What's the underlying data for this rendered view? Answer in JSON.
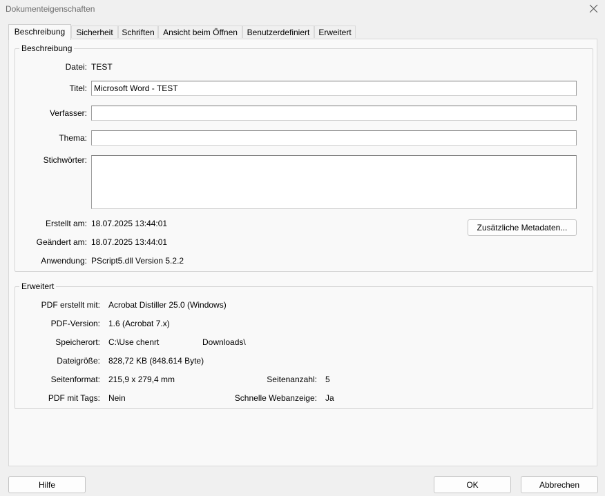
{
  "window": {
    "title": "Dokumenteigenschaften"
  },
  "tabs": [
    {
      "label": "Beschreibung",
      "active": true
    },
    {
      "label": "Sicherheit"
    },
    {
      "label": "Schriften"
    },
    {
      "label": "Ansicht beim Öffnen"
    },
    {
      "label": "Benutzerdefiniert"
    },
    {
      "label": "Erweitert"
    }
  ],
  "description": {
    "group_label": "Beschreibung",
    "file_label": "Datei:",
    "file_value": "TEST",
    "title_label": "Titel:",
    "title_value": "Microsoft Word - TEST",
    "author_label": "Verfasser:",
    "author_value": "",
    "subject_label": "Thema:",
    "subject_value": "",
    "keywords_label": "Stichwörter:",
    "keywords_value": "",
    "created_label": "Erstellt am:",
    "created_value": "18.07.2025 13:44:01",
    "modified_label": "Geändert am:",
    "modified_value": "18.07.2025 13:44:01",
    "application_label": "Anwendung:",
    "application_value": "PScript5.dll Version 5.2.2",
    "metadata_button": "Zusätzliche Metadaten..."
  },
  "advanced": {
    "group_label": "Erweitert",
    "producer_label": "PDF erstellt mit:",
    "producer_value": "Acrobat Distiller 25.0 (Windows)",
    "version_label": "PDF-Version:",
    "version_value": "1.6 (Acrobat 7.x)",
    "location_label": "Speicherort:",
    "location_prefix": "C:\\Use chenrt",
    "location_suffix": "Downloads\\",
    "size_label": "Dateigröße:",
    "size_value": "828,72 KB (848.614 Byte)",
    "pagesize_label": "Seitenformat:",
    "pagesize_value": "215,9 x 279,4 mm",
    "pagecount_label": "Seitenanzahl:",
    "pagecount_value": "5",
    "tagged_label": "PDF mit Tags:",
    "tagged_value": "Nein",
    "fastweb_label": "Schnelle Webanzeige:",
    "fastweb_value": "Ja"
  },
  "buttons": {
    "help": "Hilfe",
    "ok": "OK",
    "cancel": "Abbrechen"
  },
  "icons": {
    "close": "close-icon"
  }
}
